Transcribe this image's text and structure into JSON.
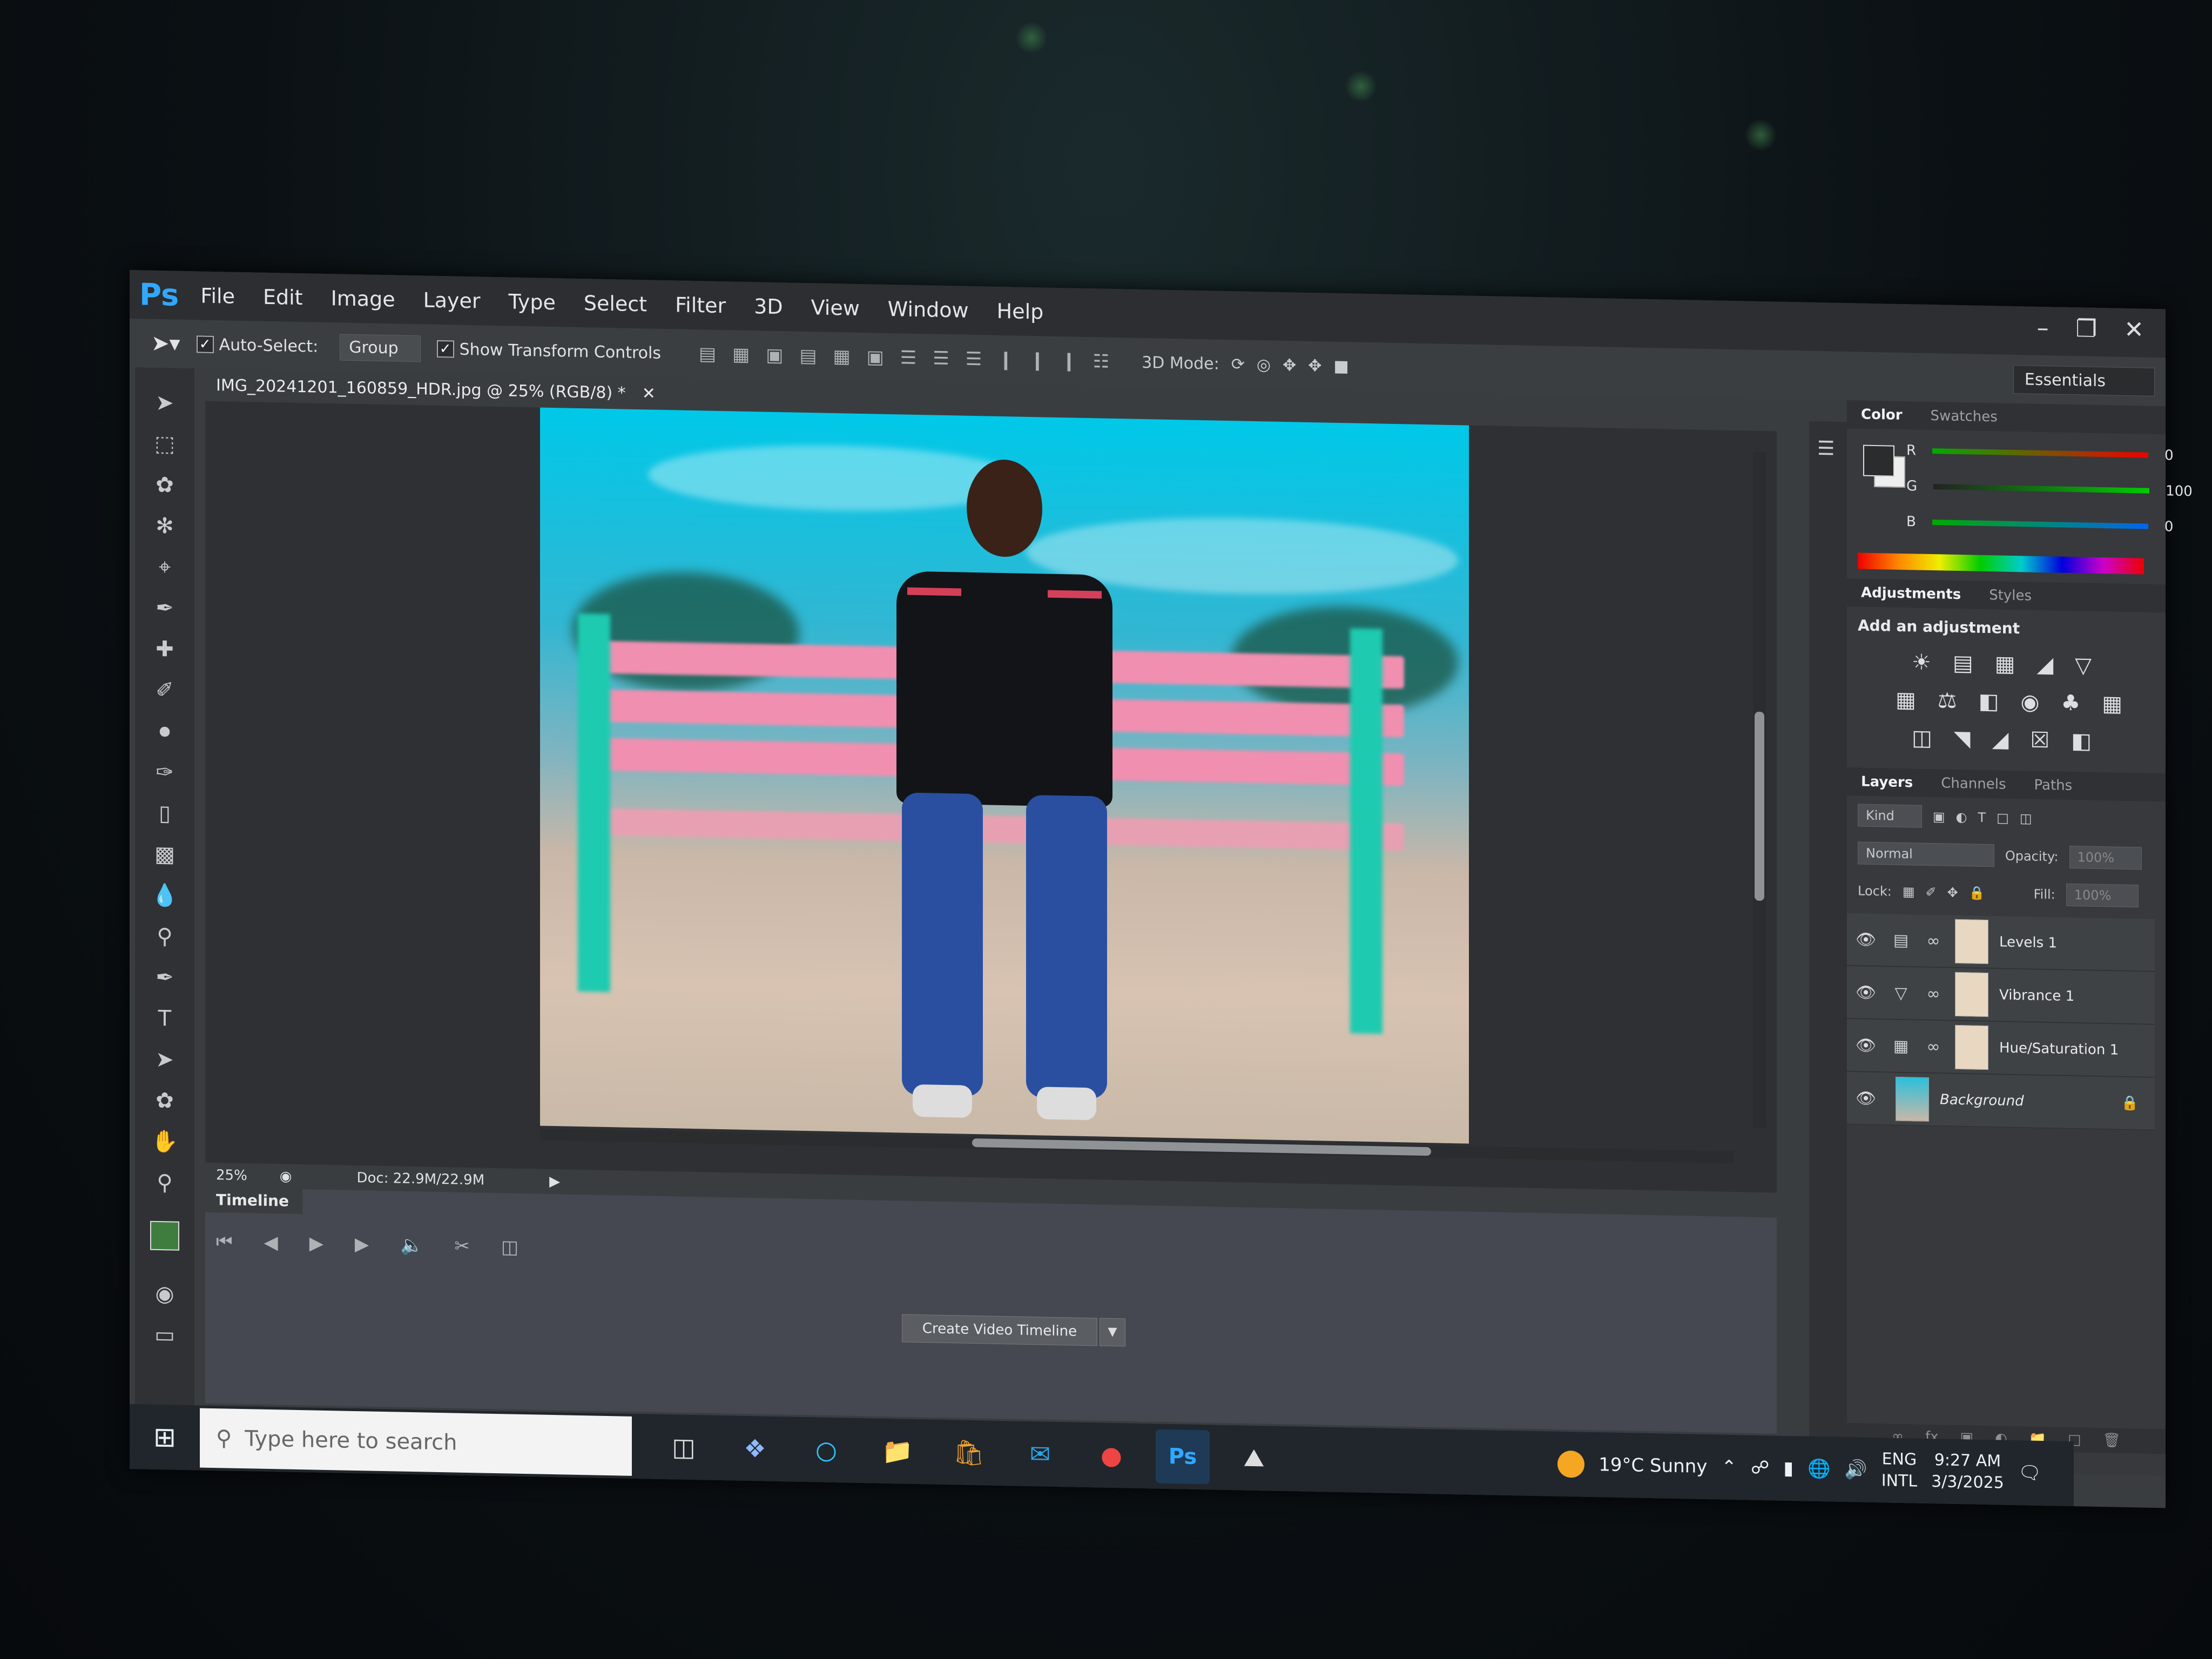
{
  "app": {
    "logo": "Ps"
  },
  "menu": [
    "File",
    "Edit",
    "Image",
    "Layer",
    "Type",
    "Select",
    "Filter",
    "3D",
    "View",
    "Window",
    "Help"
  ],
  "options": {
    "auto_select_label": "Auto-Select:",
    "auto_select_value": "Group",
    "show_transform_label": "Show Transform Controls",
    "mode_3d_label": "3D Mode:",
    "workspace": "Essentials"
  },
  "document": {
    "tab_title": "IMG_20241201_160859_HDR.jpg @ 25% (RGB/8) *",
    "zoom": "25%",
    "doc_size": "Doc: 22.9M/22.9M"
  },
  "timeline": {
    "tab_label": "Timeline",
    "create_button": "Create Video Timeline"
  },
  "color_panel": {
    "tabs": [
      "Color",
      "Swatches"
    ],
    "channels": [
      {
        "label": "R",
        "value": "0"
      },
      {
        "label": "G",
        "value": "100"
      },
      {
        "label": "B",
        "value": "0"
      }
    ]
  },
  "adjustments_panel": {
    "tabs": [
      "Adjustments",
      "Styles"
    ],
    "title": "Add an adjustment"
  },
  "layers_panel": {
    "tabs": [
      "Layers",
      "Channels",
      "Paths"
    ],
    "filter_kind": "Kind",
    "blend_mode": "Normal",
    "opacity_label": "Opacity:",
    "opacity_value": "100%",
    "lock_label": "Lock:",
    "fill_label": "Fill:",
    "fill_value": "100%",
    "layers": [
      {
        "name": "Levels 1"
      },
      {
        "name": "Vibrance 1"
      },
      {
        "name": "Hue/Saturation 1"
      },
      {
        "name": "Background"
      }
    ]
  },
  "taskbar": {
    "search_placeholder": "Type here to search",
    "weather": "19°C  Sunny",
    "lang_top": "ENG",
    "lang_bottom": "INTL",
    "time": "9:27 AM",
    "date": "3/3/2025",
    "ps_icon": "Ps"
  },
  "colors": {
    "fg_swatch": "#3f7d3f",
    "ps_blue": "#31a8ff"
  }
}
